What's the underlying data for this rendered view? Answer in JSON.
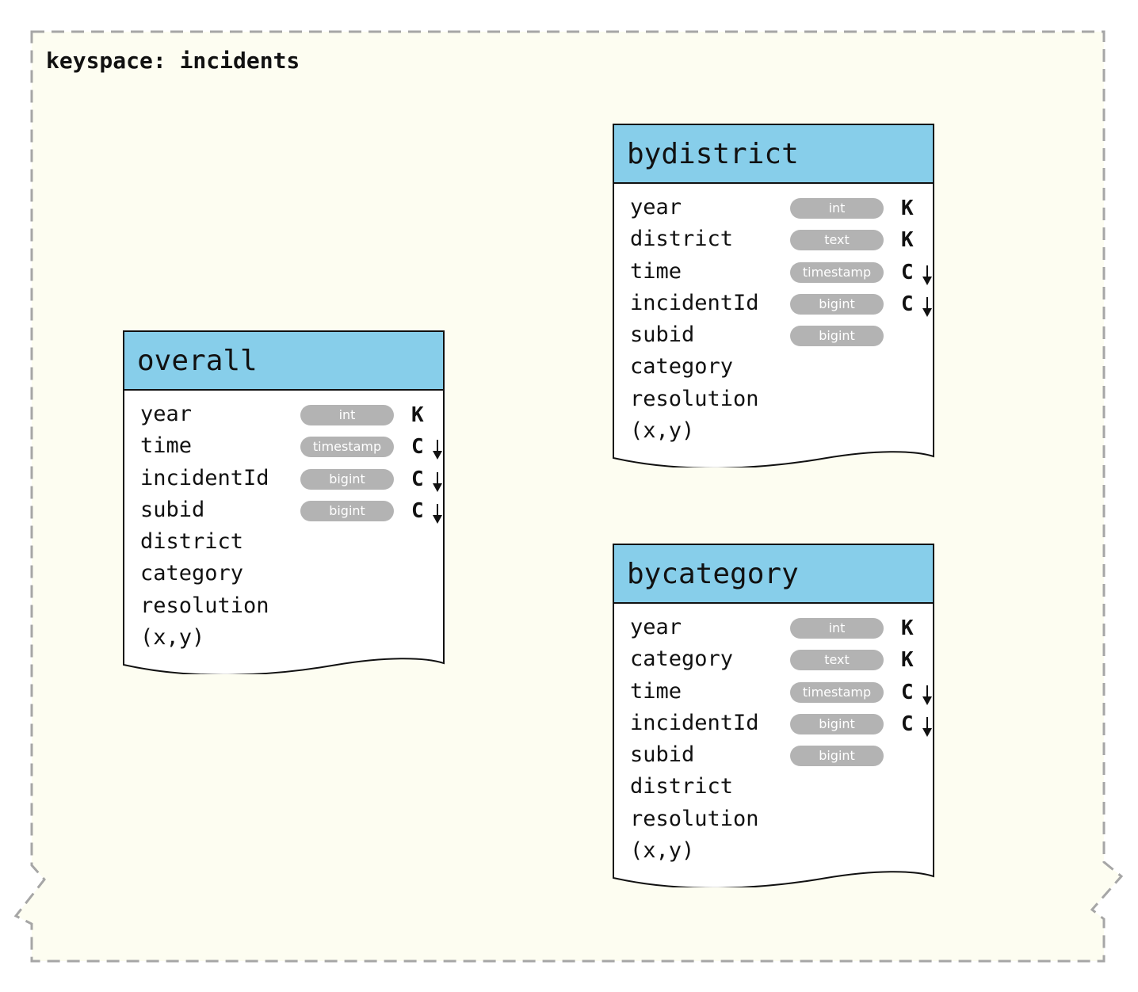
{
  "keyspace": {
    "title": "keyspace: incidents"
  },
  "tables": {
    "overall": {
      "name": "overall",
      "columns": [
        {
          "name": "year",
          "type": "int",
          "key": "K",
          "order": ""
        },
        {
          "name": "time",
          "type": "timestamp",
          "key": "C",
          "order": "desc"
        },
        {
          "name": "incidentId",
          "type": "bigint",
          "key": "C",
          "order": "desc"
        },
        {
          "name": "subid",
          "type": "bigint",
          "key": "C",
          "order": "desc"
        },
        {
          "name": "district",
          "type": "",
          "key": "",
          "order": ""
        },
        {
          "name": "category",
          "type": "",
          "key": "",
          "order": ""
        },
        {
          "name": "resolution",
          "type": "",
          "key": "",
          "order": ""
        },
        {
          "name": "(x,y)",
          "type": "",
          "key": "",
          "order": ""
        }
      ]
    },
    "bydistrict": {
      "name": "bydistrict",
      "columns": [
        {
          "name": "year",
          "type": "int",
          "key": "K",
          "order": ""
        },
        {
          "name": "district",
          "type": "text",
          "key": "K",
          "order": ""
        },
        {
          "name": "time",
          "type": "timestamp",
          "key": "C",
          "order": "desc"
        },
        {
          "name": "incidentId",
          "type": "bigint",
          "key": "C",
          "order": "desc"
        },
        {
          "name": "subid",
          "type": "bigint",
          "key": "",
          "order": ""
        },
        {
          "name": "category",
          "type": "",
          "key": "",
          "order": ""
        },
        {
          "name": "resolution",
          "type": "",
          "key": "",
          "order": ""
        },
        {
          "name": "(x,y)",
          "type": "",
          "key": "",
          "order": ""
        }
      ]
    },
    "bycategory": {
      "name": "bycategory",
      "columns": [
        {
          "name": "year",
          "type": "int",
          "key": "K",
          "order": ""
        },
        {
          "name": "category",
          "type": "text",
          "key": "K",
          "order": ""
        },
        {
          "name": "time",
          "type": "timestamp",
          "key": "C",
          "order": "desc"
        },
        {
          "name": "incidentId",
          "type": "bigint",
          "key": "C",
          "order": "desc"
        },
        {
          "name": "subid",
          "type": "bigint",
          "key": "",
          "order": ""
        },
        {
          "name": "district",
          "type": "",
          "key": "",
          "order": ""
        },
        {
          "name": "resolution",
          "type": "",
          "key": "",
          "order": ""
        },
        {
          "name": "(x,y)",
          "type": "",
          "key": "",
          "order": ""
        }
      ]
    }
  },
  "colors": {
    "keyspace_fill": "#fdfdf1",
    "keyspace_border": "#a6a6a6",
    "header_fill": "#87ceea",
    "type_pill": "#b3b3b3",
    "outline": "#111111"
  }
}
